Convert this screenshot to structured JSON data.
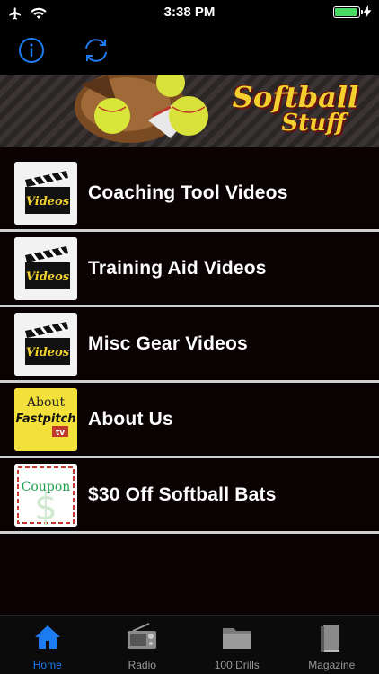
{
  "status_bar": {
    "time": "3:38 PM",
    "battery_level": 1.0,
    "battery_color": "#4cd964"
  },
  "nav_bar": {
    "left_icon": "info-icon",
    "right_icon": "refresh-icon",
    "accent_color": "#1e7cf2"
  },
  "banner": {
    "title_line1": "Softball",
    "title_line2": "Stuff"
  },
  "menu": {
    "items": [
      {
        "label": "Coaching Tool Videos",
        "thumb_text": "Videos",
        "icon": "video-clapperboard-icon"
      },
      {
        "label": "Training Aid Videos",
        "thumb_text": "Videos",
        "icon": "video-clapperboard-icon"
      },
      {
        "label": "Misc Gear Videos",
        "thumb_text": "Videos",
        "icon": "video-clapperboard-icon"
      },
      {
        "label": "About Us",
        "thumb_text_top": "About",
        "thumb_text_main": "Fastpitch",
        "thumb_text_badge": "tv",
        "icon": "about-fastpitch-icon"
      },
      {
        "label": "$30 Off Softball Bats",
        "thumb_text": "Coupon",
        "icon": "coupon-icon"
      }
    ]
  },
  "tab_bar": {
    "tabs": [
      {
        "label": "Home",
        "icon": "home-icon",
        "active": true
      },
      {
        "label": "Radio",
        "icon": "radio-icon",
        "active": false
      },
      {
        "label": "100 Drills",
        "icon": "folder-icon",
        "active": false
      },
      {
        "label": "Magazine",
        "icon": "book-icon",
        "active": false
      }
    ]
  }
}
